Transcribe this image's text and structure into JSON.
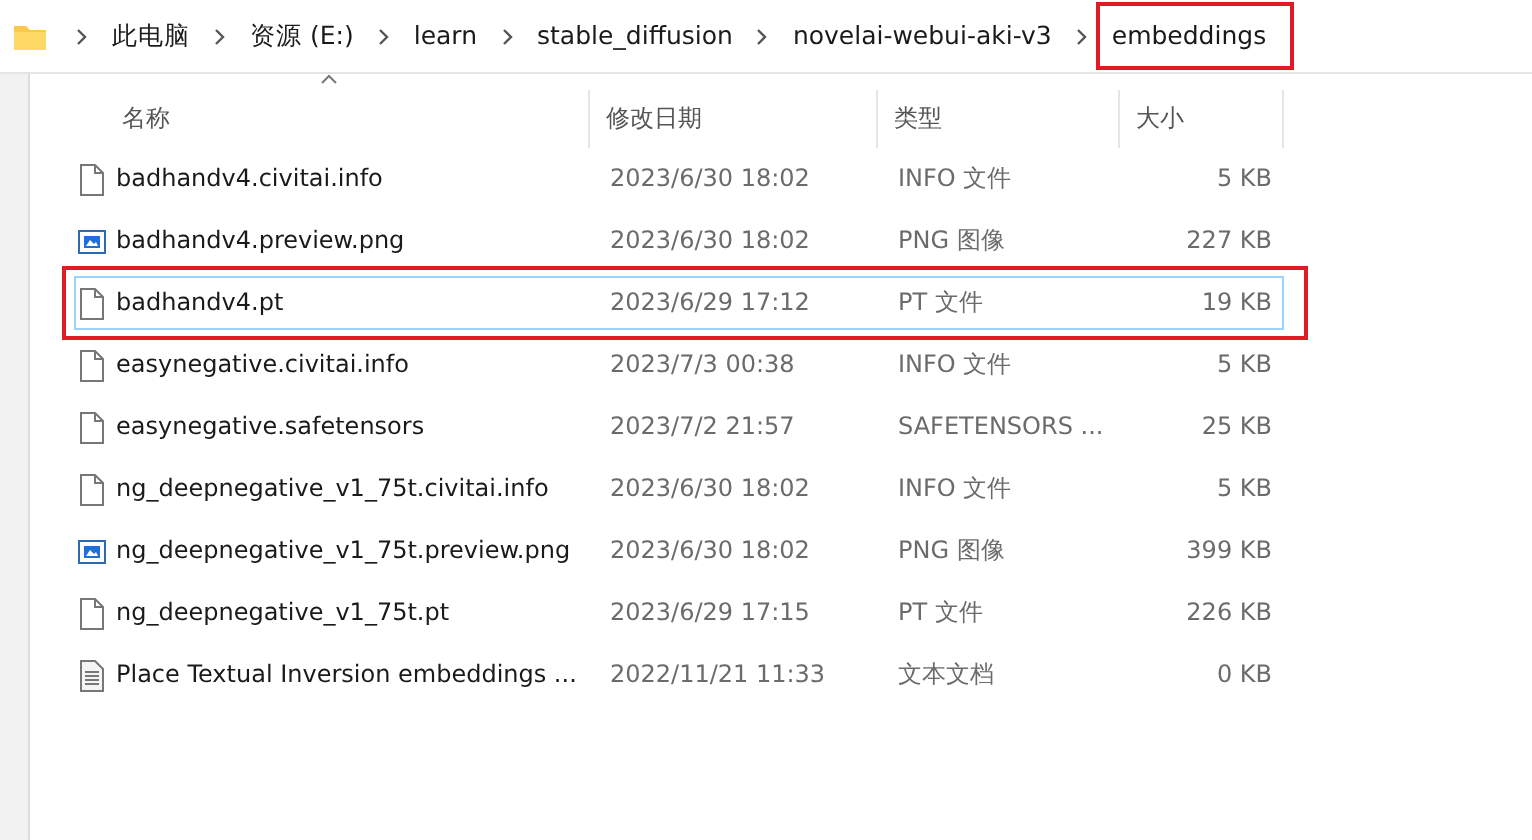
{
  "breadcrumb": [
    {
      "label": "此电脑",
      "annotated": false
    },
    {
      "label": "资源 (E:)",
      "annotated": false
    },
    {
      "label": "learn",
      "annotated": false
    },
    {
      "label": "stable_diffusion",
      "annotated": false
    },
    {
      "label": "novelai-webui-aki-v3",
      "annotated": false
    },
    {
      "label": "embeddings",
      "annotated": true
    }
  ],
  "columns": [
    {
      "label": "名称",
      "sorted": true
    },
    {
      "label": "修改日期",
      "sorted": false
    },
    {
      "label": "类型",
      "sorted": false
    },
    {
      "label": "大小",
      "sorted": false
    }
  ],
  "rows": [
    {
      "kind": "file",
      "name": "badhandv4.civitai.info",
      "date": "2023/6/30 18:02",
      "type": "INFO 文件",
      "size": "5 KB",
      "focused": false,
      "annotated": false
    },
    {
      "kind": "image",
      "name": "badhandv4.preview.png",
      "date": "2023/6/30 18:02",
      "type": "PNG 图像",
      "size": "227 KB",
      "focused": false,
      "annotated": false
    },
    {
      "kind": "file",
      "name": "badhandv4.pt",
      "date": "2023/6/29 17:12",
      "type": "PT 文件",
      "size": "19 KB",
      "focused": true,
      "annotated": true
    },
    {
      "kind": "file",
      "name": "easynegative.civitai.info",
      "date": "2023/7/3 00:38",
      "type": "INFO 文件",
      "size": "5 KB",
      "focused": false,
      "annotated": false
    },
    {
      "kind": "file",
      "name": "easynegative.safetensors",
      "date": "2023/7/2 21:57",
      "type": "SAFETENSORS ...",
      "size": "25 KB",
      "focused": false,
      "annotated": false
    },
    {
      "kind": "file",
      "name": "ng_deepnegative_v1_75t.civitai.info",
      "date": "2023/6/30 18:02",
      "type": "INFO 文件",
      "size": "5 KB",
      "focused": false,
      "annotated": false
    },
    {
      "kind": "image",
      "name": "ng_deepnegative_v1_75t.preview.png",
      "date": "2023/6/30 18:02",
      "type": "PNG 图像",
      "size": "399 KB",
      "focused": false,
      "annotated": false
    },
    {
      "kind": "file",
      "name": "ng_deepnegative_v1_75t.pt",
      "date": "2023/6/29 17:15",
      "type": "PT 文件",
      "size": "226 KB",
      "focused": false,
      "annotated": false
    },
    {
      "kind": "text",
      "name": "Place Textual Inversion embeddings ...",
      "date": "2022/11/21 11:33",
      "type": "文本文档",
      "size": "0 KB",
      "focused": false,
      "annotated": false
    }
  ]
}
